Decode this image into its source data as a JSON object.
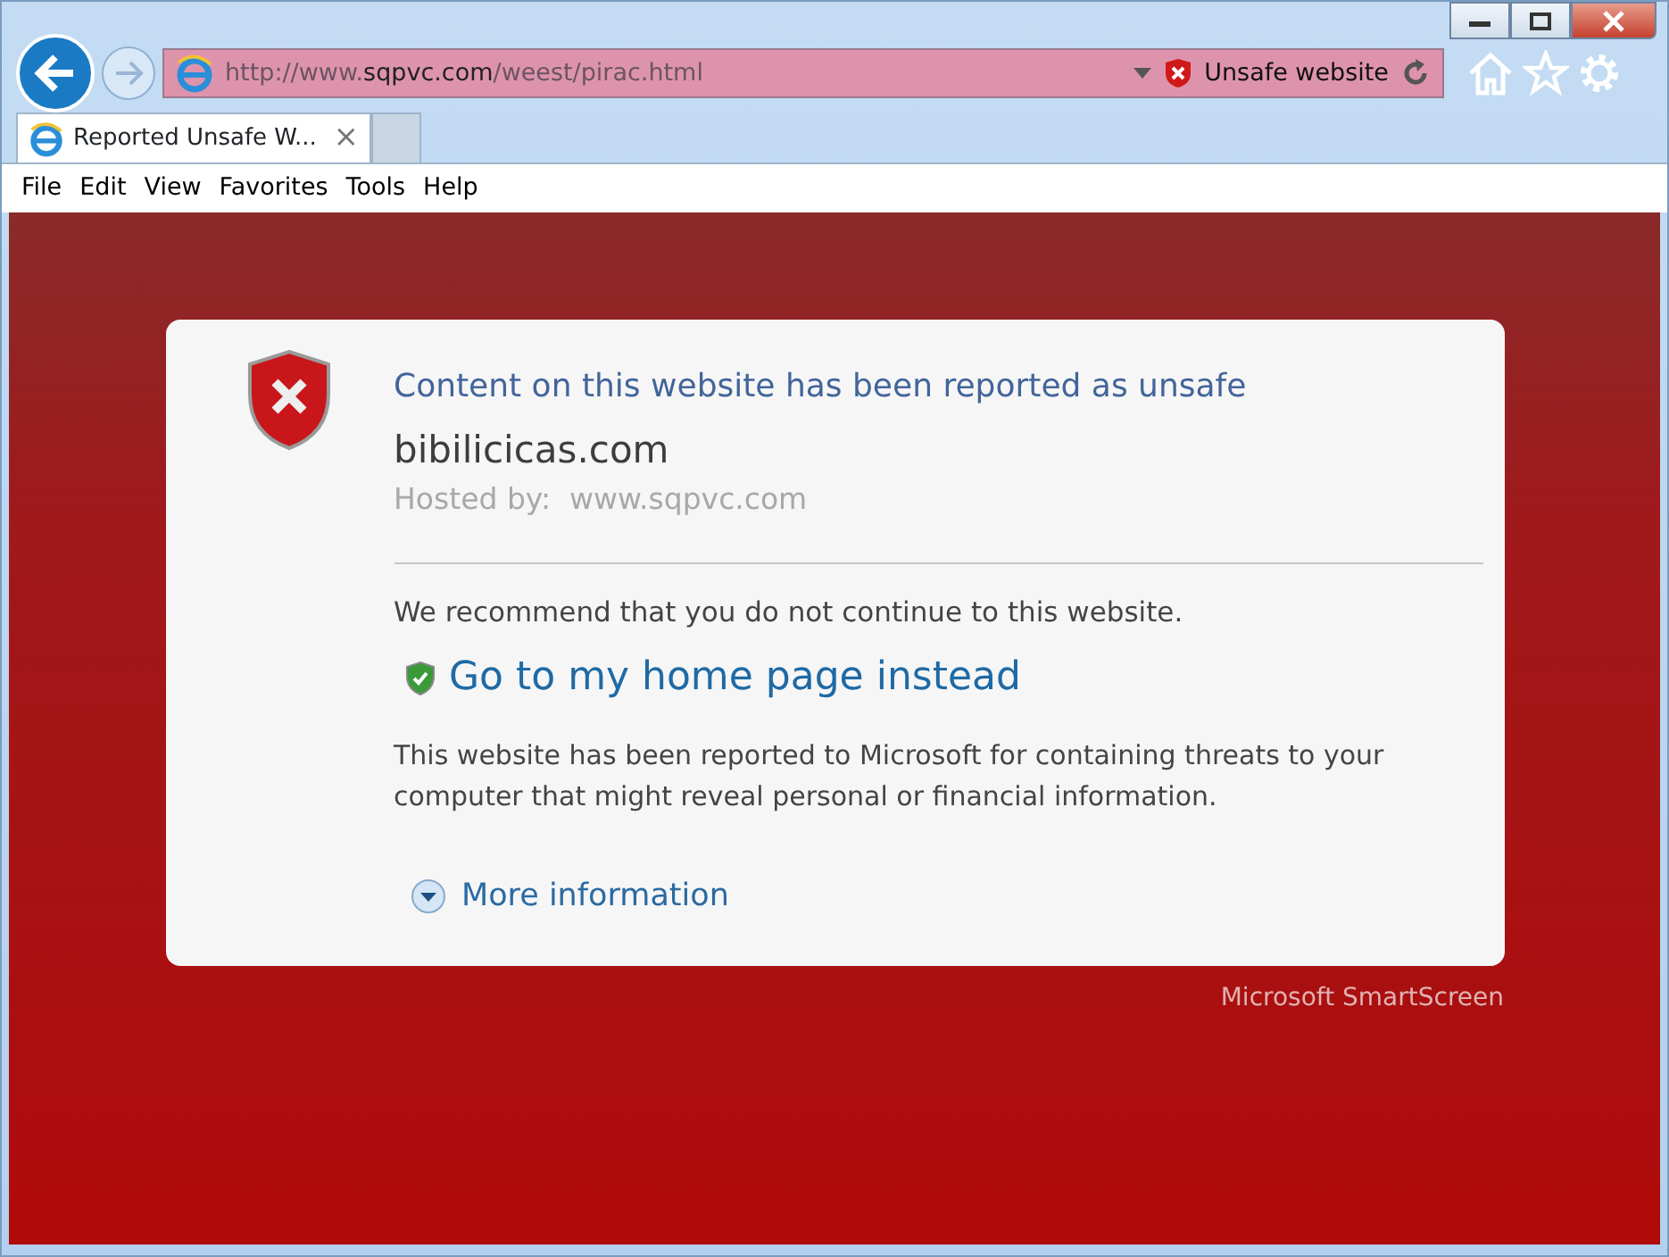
{
  "address_bar": {
    "prefix": "http://www.",
    "domain": "sqpvc.com",
    "path": "/weest/pirac.html",
    "status": "Unsafe website"
  },
  "tabs": [
    {
      "label": "Reported Unsafe W...",
      "selected": true,
      "close": "×"
    }
  ],
  "menu": [
    "File",
    "Edit",
    "View",
    "Favorites",
    "Tools",
    "Help"
  ],
  "warning": {
    "heading": "Content on this website has been reported as unsafe",
    "site": "bibilicicas.com",
    "hosted_label": "Hosted by:",
    "hosted_value": "www.sqpvc.com",
    "recommendation": "We recommend that you do not continue to this website.",
    "home_link": "Go to my home page instead",
    "explanation": "This website has been reported to Microsoft for containing threats to your computer that might reveal personal or financial information.",
    "more_info": "More information",
    "more_expanded": false
  },
  "footer": "Microsoft SmartScreen"
}
